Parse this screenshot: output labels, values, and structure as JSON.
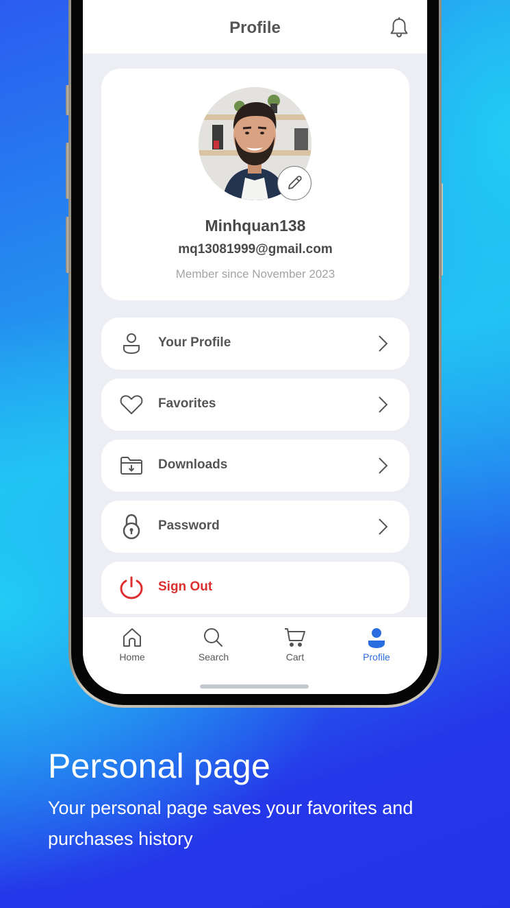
{
  "app": {
    "title": "Profile"
  },
  "header": {
    "icons": {
      "notifications": "bell-icon"
    }
  },
  "profile": {
    "username": "Minhquan138",
    "email": "mq13081999@gmail.com",
    "member_since": "Member since November 2023",
    "avatar_icon": "avatar-photo",
    "edit_icon": "pencil-icon"
  },
  "menu": {
    "items": [
      {
        "label": "Your Profile",
        "icon": "user-outline-icon"
      },
      {
        "label": "Favorites",
        "icon": "heart-icon"
      },
      {
        "label": "Downloads",
        "icon": "folder-download-icon"
      },
      {
        "label": "Password",
        "icon": "lock-icon"
      },
      {
        "label": "Sign Out",
        "icon": "power-icon"
      }
    ]
  },
  "bottom_nav": {
    "items": [
      {
        "label": "Home",
        "icon": "home-icon",
        "active": false
      },
      {
        "label": "Search",
        "icon": "search-icon",
        "active": false
      },
      {
        "label": "Cart",
        "icon": "cart-icon",
        "active": false
      },
      {
        "label": "Profile",
        "icon": "profile-filled-icon",
        "active": true
      }
    ]
  },
  "caption": {
    "title": "Personal page",
    "text": "Your personal page saves your favorites and purchases history"
  },
  "colors": {
    "accent": "#2a6de0",
    "danger": "#dd2f2f",
    "text": "#555555",
    "screen_bg": "#eceef3"
  }
}
